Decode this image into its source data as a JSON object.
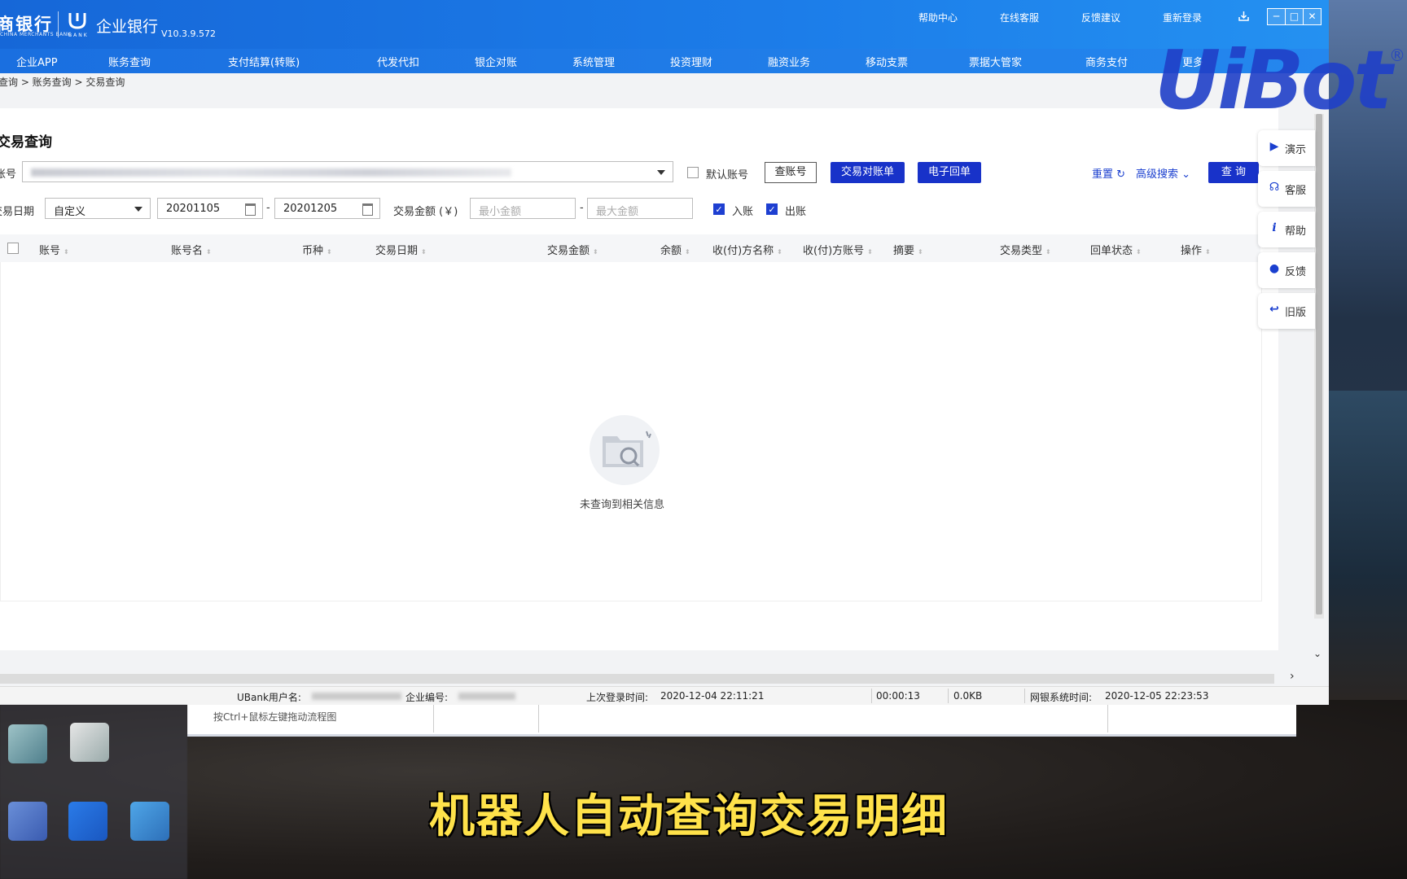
{
  "app": {
    "bank_cn": "商银行",
    "bank_en": "CHINA MERCHANTS BANK",
    "ubank_en": "BANK",
    "product": "企业银行",
    "version": "V10.3.9.572"
  },
  "top_links": [
    "帮助中心",
    "在线客服",
    "反馈建议",
    "重新登录"
  ],
  "nav": [
    "企业APP",
    "账务查询",
    "支付结算(转账)",
    "代发代扣",
    "银企对账",
    "系统管理",
    "投资理财",
    "融资业务",
    "移动支票",
    "票据大管家",
    "商务支付",
    "更多"
  ],
  "breadcrumb": "查询 > 账务查询 > 交易查询",
  "page_title": "交易查询",
  "form": {
    "account_label": "账号",
    "default_account_label": "默认账号",
    "check_account_btn": "查账号",
    "reconcile_btn": "交易对账单",
    "receipt_btn": "电子回单",
    "reset_label": "重置",
    "advanced_label": "高级搜索",
    "query_btn": "查 询",
    "date_label": "交易日期",
    "date_mode": "自定义",
    "date_from": "20201105",
    "date_to": "20201205",
    "date_sep": "-",
    "amount_label": "交易金额 (￥)",
    "min_amount_ph": "最小金额",
    "max_amount_ph": "最大金额",
    "amount_sep": "-",
    "income_label": "入账",
    "outgo_label": "出账"
  },
  "table": {
    "columns": [
      "账号",
      "账号名",
      "币种",
      "交易日期",
      "交易金额",
      "余额",
      "收(付)方名称",
      "收(付)方账号",
      "摘要",
      "交易类型",
      "回单状态",
      "操作"
    ],
    "empty_text": "未查询到相关信息"
  },
  "side_menu": [
    {
      "icon": "play-icon",
      "label": "演示"
    },
    {
      "icon": "headset-icon",
      "label": "客服"
    },
    {
      "icon": "info-icon",
      "label": "帮助"
    },
    {
      "icon": "chat-icon",
      "label": "反馈"
    },
    {
      "icon": "back-arrow-icon",
      "label": "旧版"
    }
  ],
  "status": {
    "user_label": "UBank用户名:",
    "company_label": "企业编号:",
    "last_login_label": "上次登录时间:",
    "last_login": "2020-12-04 22:11:21",
    "elapsed": "00:00:13",
    "traffic": "0.0KB",
    "sys_time_label": "网银系统时间:",
    "sys_time": "2020-12-05 22:23:53"
  },
  "under_window_hint": "按Ctrl+鼠标左键拖动流程图",
  "watermark": "UiBot",
  "subtitle": "机器人自动查询交易明细",
  "colors": {
    "brand_blue": "#1c7de9",
    "button_blue": "#1832c9",
    "subtitle_yellow": "#ffe24a"
  }
}
